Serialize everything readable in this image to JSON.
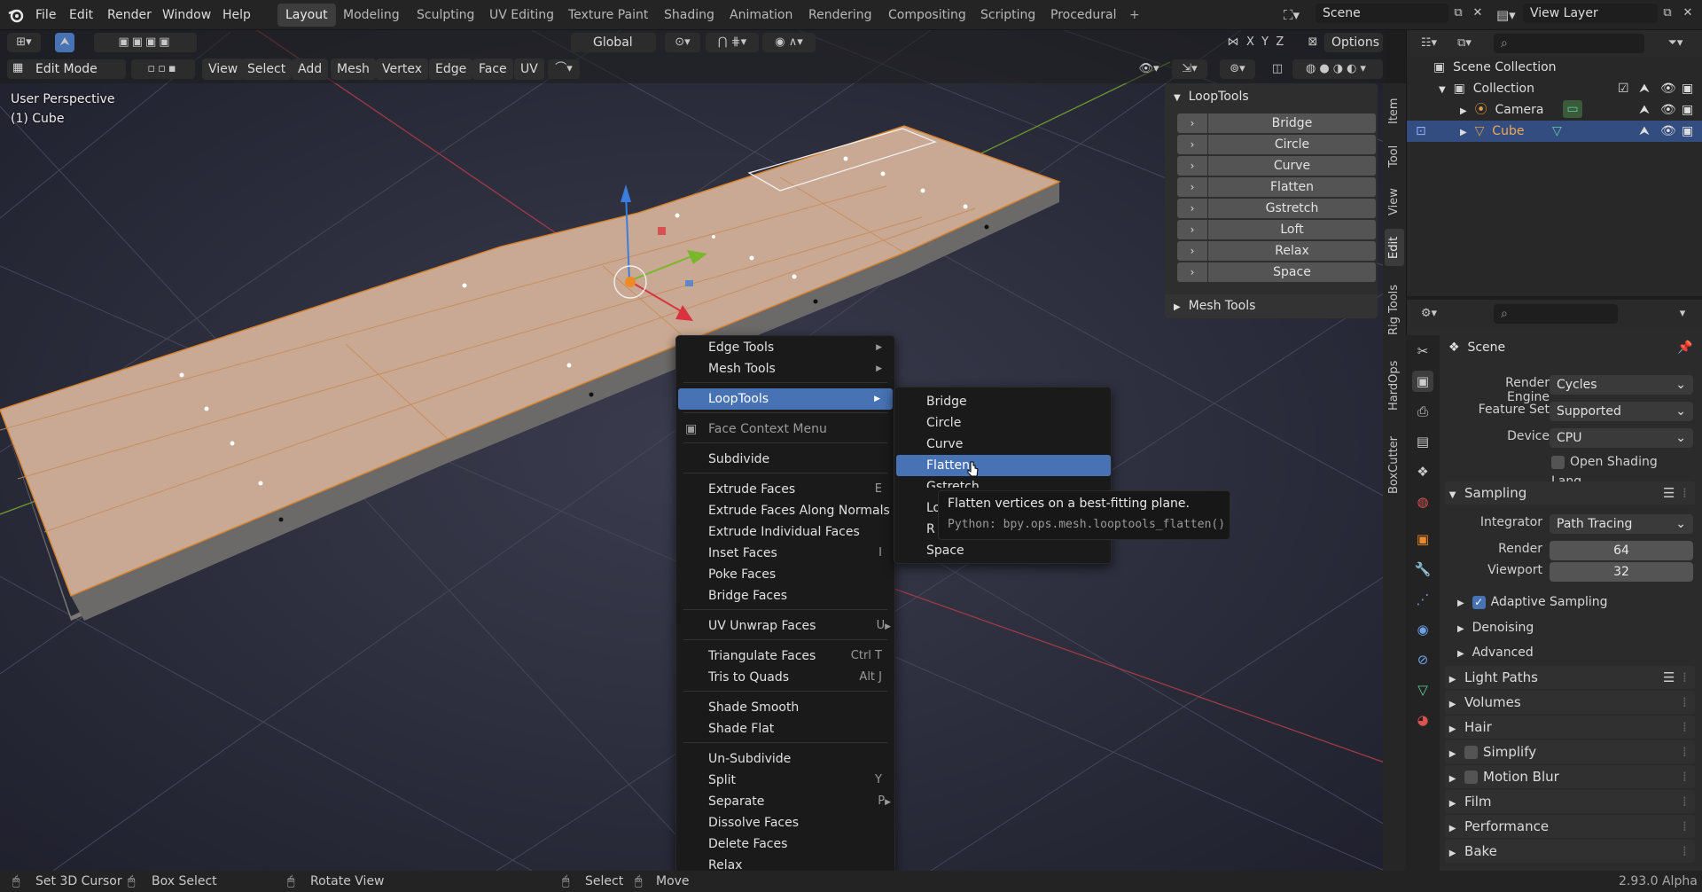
{
  "topbar": {
    "menus": [
      "File",
      "Edit",
      "Render",
      "Window",
      "Help"
    ],
    "workspaces": [
      "Layout",
      "Modeling",
      "Sculpting",
      "UV Editing",
      "Texture Paint",
      "Shading",
      "Animation",
      "Rendering",
      "Compositing",
      "Scripting",
      "Procedural"
    ],
    "active_workspace": "Layout",
    "add_tab": "+",
    "scene": "Scene",
    "view_layer": "View Layer"
  },
  "viewport_header": {
    "transform_orientation": "Global",
    "options": "Options",
    "axes": [
      "X",
      "Y",
      "Z"
    ],
    "mode": "Edit Mode",
    "menus": [
      "View",
      "Select",
      "Add",
      "Mesh",
      "Vertex",
      "Edge",
      "Face",
      "UV"
    ]
  },
  "viewport": {
    "perspective": "User Perspective",
    "object": "(1) Cube"
  },
  "npanel": {
    "title": "LoopTools",
    "buttons": [
      "Bridge",
      "Circle",
      "Curve",
      "Flatten",
      "Gstretch",
      "Loft",
      "Relax",
      "Space"
    ],
    "collapsed_panel": "Mesh Tools",
    "tabs": [
      "Item",
      "Tool",
      "View",
      "Edit",
      "Rig Tools",
      "HardOps",
      "BoxCutter"
    ],
    "active_tab": "Edit"
  },
  "outliner": {
    "root": "Scene Collection",
    "collection": "Collection",
    "objects": [
      "Camera",
      "Cube"
    ],
    "selected": "Cube"
  },
  "properties": {
    "scene_name": "Scene",
    "render_engine_label": "Render Engine",
    "render_engine": "Cycles",
    "feature_set_label": "Feature Set",
    "feature_set": "Supported",
    "device_label": "Device",
    "device": "CPU",
    "osl": "Open Shading Lang...",
    "sampling": "Sampling",
    "integrator_label": "Integrator",
    "integrator": "Path Tracing",
    "render_label": "Render",
    "render_samples": "64",
    "viewport_label": "Viewport",
    "viewport_samples": "32",
    "adaptive_sampling": "Adaptive Sampling",
    "subsections": [
      "Denoising",
      "Advanced"
    ],
    "sections": [
      "Light Paths",
      "Volumes",
      "Hair",
      "Simplify",
      "Motion Blur",
      "Film",
      "Performance",
      "Bake"
    ]
  },
  "context_menu": {
    "items": [
      {
        "label": "Edge Tools",
        "shortcut": "",
        "submenu": true
      },
      {
        "label": "Mesh Tools",
        "shortcut": "",
        "submenu": true
      },
      {
        "label": "LoopTools",
        "shortcut": "",
        "submenu": true
      },
      {
        "label": "Face Context Menu",
        "shortcut": "",
        "submenu": false
      },
      {
        "label": "Subdivide",
        "shortcut": "",
        "submenu": false
      },
      {
        "label": "Extrude Faces",
        "shortcut": "E",
        "submenu": false
      },
      {
        "label": "Extrude Faces Along Normals",
        "shortcut": "",
        "submenu": false
      },
      {
        "label": "Extrude Individual Faces",
        "shortcut": "",
        "submenu": false
      },
      {
        "label": "Inset Faces",
        "shortcut": "I",
        "submenu": false
      },
      {
        "label": "Poke Faces",
        "shortcut": "",
        "submenu": false
      },
      {
        "label": "Bridge Faces",
        "shortcut": "",
        "submenu": false
      },
      {
        "label": "UV Unwrap Faces",
        "shortcut": "U",
        "submenu": true
      },
      {
        "label": "Triangulate Faces",
        "shortcut": "Ctrl T",
        "submenu": false
      },
      {
        "label": "Tris to Quads",
        "shortcut": "Alt J",
        "submenu": false
      },
      {
        "label": "Shade Smooth",
        "shortcut": "",
        "submenu": false
      },
      {
        "label": "Shade Flat",
        "shortcut": "",
        "submenu": false
      },
      {
        "label": "Un-Subdivide",
        "shortcut": "",
        "submenu": false
      },
      {
        "label": "Split",
        "shortcut": "Y",
        "submenu": false
      },
      {
        "label": "Separate",
        "shortcut": "P",
        "submenu": true
      },
      {
        "label": "Dissolve Faces",
        "shortcut": "",
        "submenu": false
      },
      {
        "label": "Delete Faces",
        "shortcut": "",
        "submenu": false
      },
      {
        "label": "Relax",
        "shortcut": "",
        "submenu": false
      }
    ],
    "highlighted": "LoopTools"
  },
  "submenu": {
    "items": [
      "Bridge",
      "Circle",
      "Curve",
      "Flatten",
      "Gstretch",
      "Loft",
      "Relax",
      "Space"
    ],
    "highlighted": "Flatten",
    "partial_labels": [
      "Lo",
      "R"
    ]
  },
  "tooltip": {
    "description": "Flatten vertices on a best-fitting plane.",
    "python": "Python: bpy.ops.mesh.looptools_flatten()"
  },
  "statusbar": {
    "items": [
      "Set 3D Cursor",
      "Box Select",
      "Rotate View",
      "Select",
      "Move"
    ],
    "version": "2.93.0 Alpha"
  },
  "colors": {
    "accent": "#4772b3",
    "mesh_face": "#c9a993",
    "selection_blue": "#334d80"
  }
}
